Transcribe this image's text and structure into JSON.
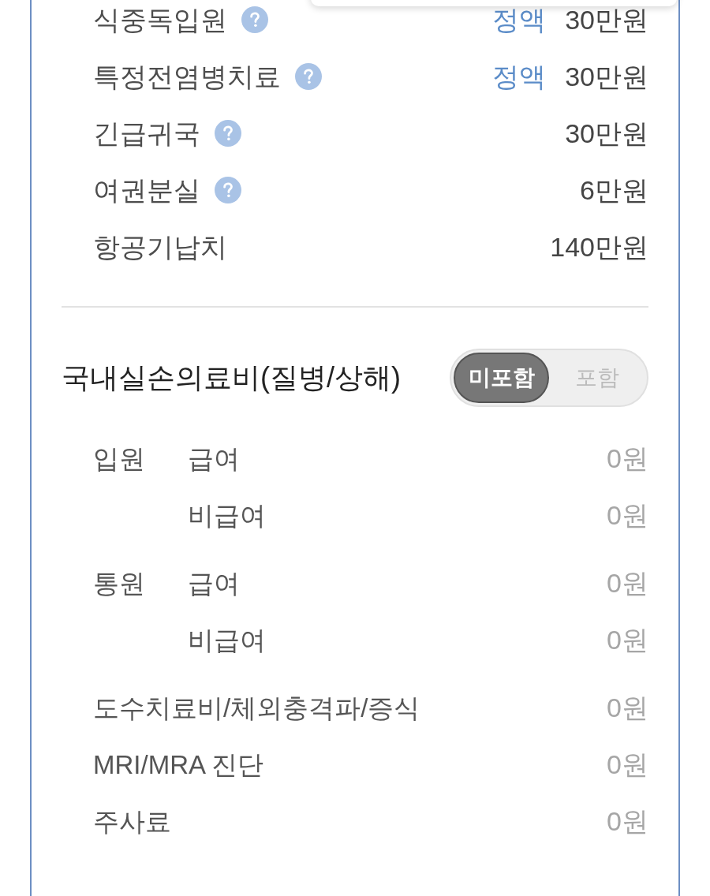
{
  "benefits": [
    {
      "label": "식중독입원",
      "help": true,
      "tag": "정액",
      "amount": "30만원"
    },
    {
      "label": "특정전염병치료",
      "help": true,
      "tag": "정액",
      "amount": "30만원"
    },
    {
      "label": "긴급귀국",
      "help": true,
      "amount": "30만원"
    },
    {
      "label": "여권분실",
      "help": true,
      "amount": "6만원"
    },
    {
      "label": "항공기납치",
      "help": false,
      "amount": "140만원"
    }
  ],
  "domestic_medical": {
    "title": "국내실손의료비(질병/상해)",
    "options": [
      {
        "label": "미포함",
        "selected": true
      },
      {
        "label": "포함",
        "selected": false
      }
    ],
    "groups": [
      {
        "label": "입원",
        "rows": [
          {
            "label": "급여",
            "amount": "0원"
          },
          {
            "label": "비급여",
            "amount": "0원"
          }
        ]
      },
      {
        "label": "통원",
        "rows": [
          {
            "label": "급여",
            "amount": "0원"
          },
          {
            "label": "비급여",
            "amount": "0원"
          }
        ]
      }
    ],
    "items": [
      {
        "label": "도수치료비/체외충격파/증식",
        "amount": "0원"
      },
      {
        "label": "MRI/MRA 진단",
        "amount": "0원"
      },
      {
        "label": "주사료",
        "amount": "0원"
      }
    ]
  }
}
